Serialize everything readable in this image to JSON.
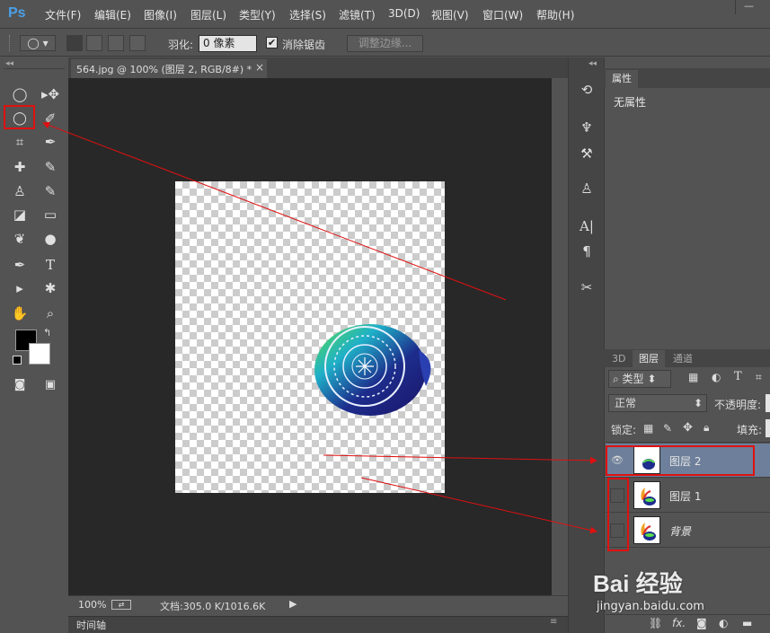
{
  "app": {
    "logo": "Ps"
  },
  "menu": [
    "文件(F)",
    "编辑(E)",
    "图像(I)",
    "图层(L)",
    "类型(Y)",
    "选择(S)",
    "滤镜(T)",
    "3D(D)",
    "视图(V)",
    "窗口(W)",
    "帮助(H)"
  ],
  "options": {
    "feather_label": "羽化:",
    "feather_value": "0 像素",
    "antialias_label": "消除锯齿",
    "antialias_checked": true,
    "refine_edge_label": "调整边缘..."
  },
  "document": {
    "tab_title": "564.jpg @ 100% (图层 2, RGB/8#) *",
    "close": "×"
  },
  "status": {
    "zoom": "100%",
    "doc_info": "文档:305.0 K/1016.6K"
  },
  "timeline": {
    "label": "时间轴"
  },
  "properties": {
    "tab": "属性",
    "content": "无属性"
  },
  "layers_panel": {
    "tabs": [
      "3D",
      "图层",
      "通道"
    ],
    "active_tab": "图层",
    "filter_label": "类型",
    "blend_mode": "正常",
    "opacity_label": "不透明度:",
    "lock_label": "锁定:",
    "fill_label": "填充:",
    "layers": [
      {
        "name": "图层 2",
        "visible": true,
        "selected": true
      },
      {
        "name": "图层 1",
        "visible": false,
        "selected": false
      },
      {
        "name": "背景",
        "visible": false,
        "selected": false
      }
    ]
  },
  "colors": {
    "foreground": "#000000",
    "background": "#ffffff",
    "annotation": "#e01010",
    "selection": "#6d7f9a"
  },
  "watermark": {
    "text": "Bai 经验",
    "url": "jingyan.baidu.com"
  }
}
